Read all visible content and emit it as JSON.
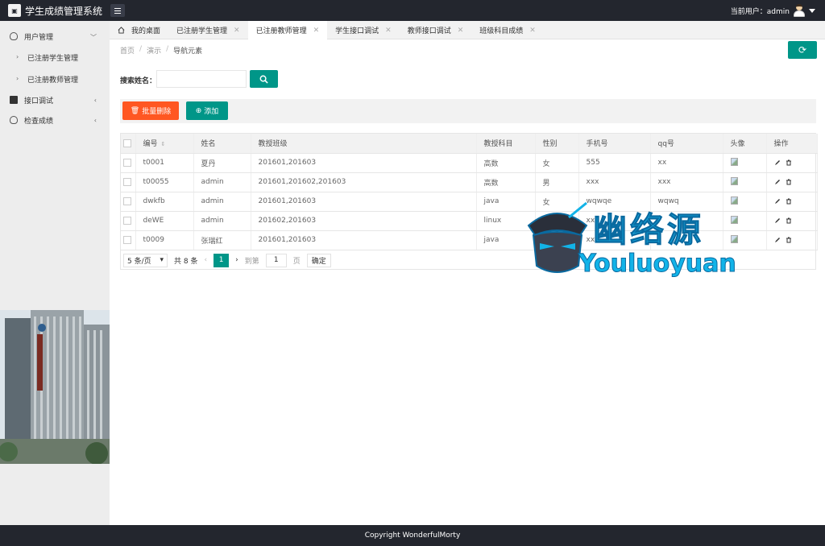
{
  "header": {
    "logo_text": "▣",
    "title": "学生成绩管理系统",
    "current_user_label": "当前用户：admin"
  },
  "sidebar": {
    "groups": [
      {
        "label": "用户管理",
        "icon": "user-icon",
        "children": [
          "已注册学生管理",
          "已注册教师管理"
        ]
      },
      {
        "label": "接口调试",
        "icon": "document-icon"
      },
      {
        "label": "检查成绩",
        "icon": "user-icon"
      }
    ]
  },
  "tabs": [
    {
      "label": "我的桌面",
      "closable": false
    },
    {
      "label": "已注册学生管理",
      "closable": true
    },
    {
      "label": "已注册教师管理",
      "closable": true,
      "active": true
    },
    {
      "label": "学生接口调试",
      "closable": true
    },
    {
      "label": "教师接口调试",
      "closable": true
    },
    {
      "label": "班级科目成绩",
      "closable": true
    }
  ],
  "breadcrumb": [
    "首页",
    "演示",
    "导航元素"
  ],
  "search": {
    "label": "搜索姓名：",
    "value": "",
    "placeholder": ""
  },
  "actions": {
    "delete_label": "批量删除",
    "add_label": "添加"
  },
  "table": {
    "headers": [
      "编号",
      "姓名",
      "教授班级",
      "教授科目",
      "性别",
      "手机号",
      "qq号",
      "头像",
      "操作"
    ],
    "rows": [
      [
        "t0001",
        "夏丹",
        "201601,201603",
        "高数",
        "女",
        "555",
        "xx"
      ],
      [
        "t00055",
        "admin",
        "201601,201602,201603",
        "高数",
        "男",
        "xxx",
        "xxx"
      ],
      [
        "dwkfb",
        "admin",
        "201601,201603",
        "java",
        "女",
        "wqwqe",
        "wqwq"
      ],
      [
        "deWE",
        "admin",
        "201602,201603",
        "linux",
        "",
        "xx",
        ""
      ],
      [
        "t0009",
        "张瑞红",
        "201601,201603",
        "java",
        "",
        "xx",
        ""
      ]
    ]
  },
  "pagination": {
    "page_size": "5 条/页",
    "total": "共 8 条",
    "current_page": "1",
    "goto_label": "到第",
    "goto_value": "1",
    "page_unit": "页",
    "confirm_label": "确定"
  },
  "footer": {
    "text": "Copyright WonderfulMorty"
  },
  "watermark": {
    "cn": "幽络源",
    "en": "Youluoyuan"
  },
  "colors": {
    "header_bg": "#23262e",
    "primary": "#009688",
    "danger": "#ff5722",
    "watermark": "#12b3e8"
  }
}
